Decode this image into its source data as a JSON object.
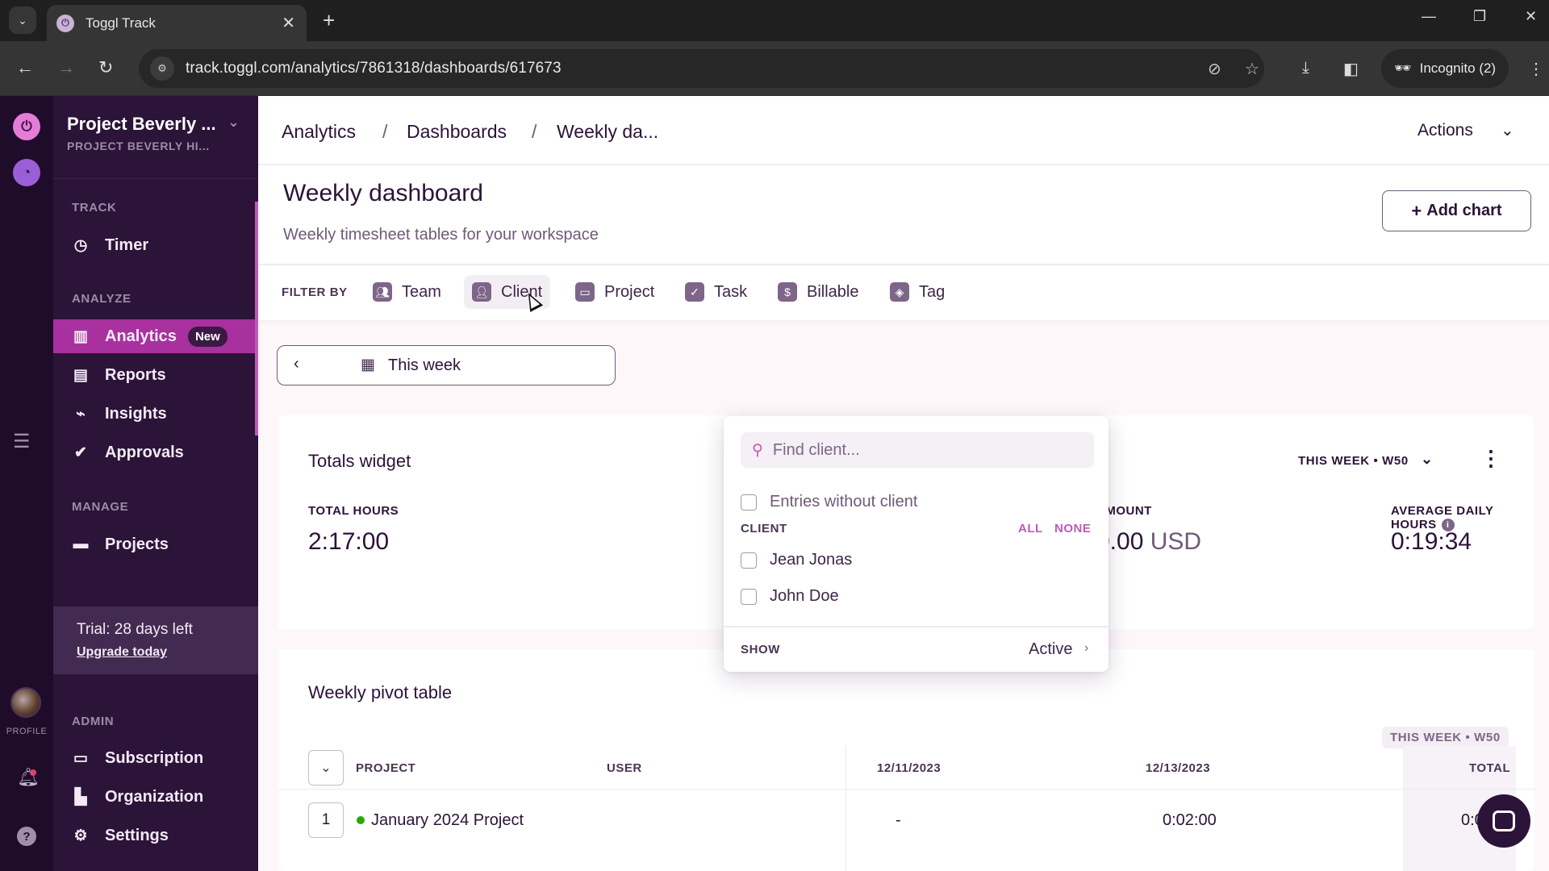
{
  "browser": {
    "tab_title": "Toggl Track",
    "url": "track.toggl.com/analytics/7861318/dashboards/617673",
    "incognito_label": "Incognito (2)"
  },
  "rail": {
    "profile_label": "PROFILE"
  },
  "sidebar": {
    "workspace_name": "Project Beverly ...",
    "workspace_sub": "PROJECT BEVERLY HI...",
    "sections": {
      "track": "TRACK",
      "analyze": "ANALYZE",
      "manage": "MANAGE",
      "admin": "ADMIN"
    },
    "items": {
      "timer": "Timer",
      "analytics": "Analytics",
      "analytics_badge": "New",
      "reports": "Reports",
      "insights": "Insights",
      "approvals": "Approvals",
      "projects": "Projects",
      "subscription": "Subscription",
      "organization": "Organization",
      "settings": "Settings"
    },
    "trial": {
      "text": "Trial: 28 days left",
      "link": "Upgrade today"
    }
  },
  "header": {
    "breadcrumb": [
      "Analytics",
      "Dashboards",
      "Weekly da..."
    ],
    "actions_label": "Actions"
  },
  "page": {
    "title": "Weekly dashboard",
    "description": "Weekly timesheet tables for your workspace",
    "add_chart_label": "Add chart"
  },
  "filters": {
    "label": "FILTER BY",
    "items": [
      "Team",
      "Client",
      "Project",
      "Task",
      "Billable",
      "Tag"
    ]
  },
  "date_picker": {
    "label": "This week"
  },
  "totals_widget": {
    "title": "Totals widget",
    "period": "THIS WEEK • W50",
    "metrics": {
      "total_hours_label": "TOTAL HOURS",
      "total_hours_value": "2:17:00",
      "amount_label": "AMOUNT",
      "amount_value": "0.00",
      "amount_unit": "USD",
      "avg_daily_label": "AVERAGE DAILY HOURS",
      "avg_daily_value": "0:19:34"
    }
  },
  "pivot_table": {
    "title": "Weekly pivot table",
    "period_badge": "THIS WEEK • W50",
    "columns": [
      "PROJECT",
      "USER",
      "12/11/2023",
      "12/13/2023",
      "TOTAL"
    ],
    "rows": [
      {
        "index": "1",
        "project": "January 2024 Project",
        "project_color": "#2da608",
        "user": "",
        "d1": "-",
        "d2": "0:02:00",
        "total": "0:02:00"
      }
    ]
  },
  "client_dropdown": {
    "search_placeholder": "Find client...",
    "without_client_label": "Entries without client",
    "section_label": "CLIENT",
    "all_label": "ALL",
    "none_label": "NONE",
    "clients": [
      "Jean Jonas",
      "John Doe"
    ],
    "show_label": "SHOW",
    "show_value": "Active"
  },
  "colors": {
    "accent": "#c158b9",
    "sidebar_bg": "#2c1338",
    "active_nav": "#a9319f",
    "text_primary": "#2c1338"
  }
}
